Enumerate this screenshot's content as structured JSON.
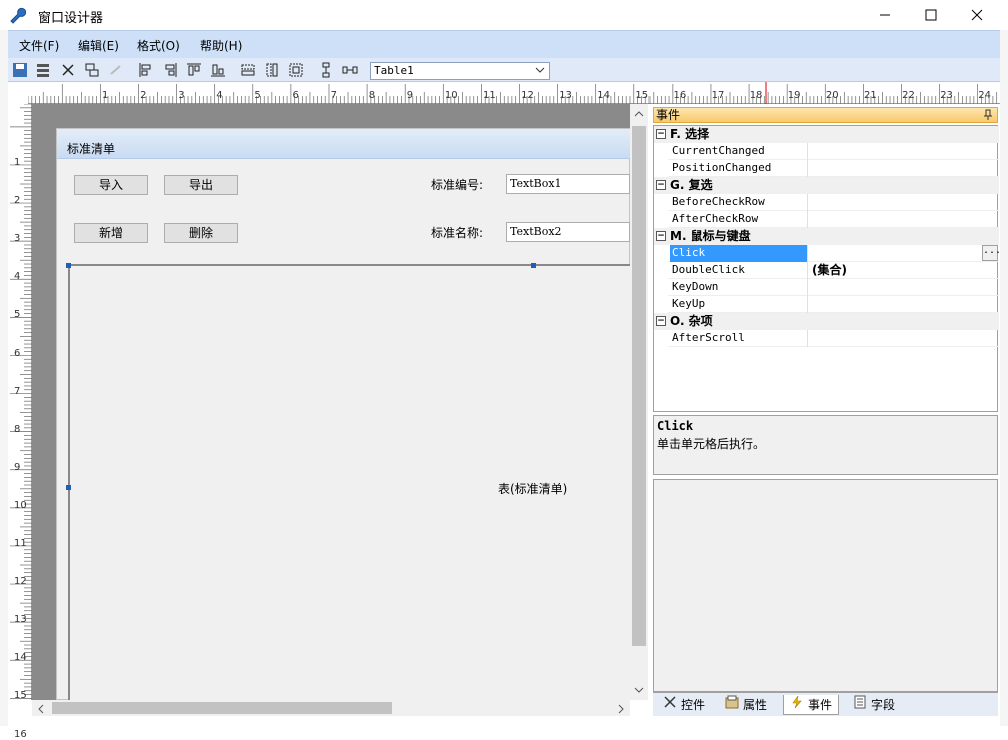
{
  "window": {
    "title": "窗口设计器"
  },
  "menu": {
    "items": [
      "文件(F)",
      "编辑(E)",
      "格式(O)",
      "帮助(H)"
    ]
  },
  "toolbar": {
    "table_select": "Table1"
  },
  "ruler": {
    "h_numbers": [
      "1",
      "2",
      "3",
      "4",
      "5",
      "6",
      "7",
      "8",
      "9",
      "10",
      "11",
      "12",
      "13",
      "14",
      "15",
      "16",
      "17",
      "18",
      "19",
      "20",
      "21",
      "22",
      "23",
      "24"
    ],
    "v_numbers": [
      "1",
      "2",
      "3",
      "4",
      "5",
      "6",
      "7",
      "8",
      "9",
      "10",
      "11",
      "12",
      "13",
      "14",
      "15",
      "16"
    ]
  },
  "form": {
    "title": "标准清单",
    "buttons": {
      "import": "导入",
      "export": "导出",
      "add": "新增",
      "delete": "删除"
    },
    "labels": {
      "code": "标准编号:",
      "name": "标准名称:"
    },
    "textboxes": {
      "code": "TextBox1",
      "name": "TextBox2"
    },
    "grid_caption": "表(标准清单)"
  },
  "props": {
    "header": "事件",
    "categories": [
      {
        "label": "F. 选择",
        "rows": [
          {
            "name": "CurrentChanged",
            "value": ""
          },
          {
            "name": "PositionChanged",
            "value": ""
          }
        ]
      },
      {
        "label": "G. 复选",
        "rows": [
          {
            "name": "BeforeCheckRow",
            "value": ""
          },
          {
            "name": "AfterCheckRow",
            "value": ""
          }
        ]
      },
      {
        "label": "M. 鼠标与键盘",
        "rows": [
          {
            "name": "Click",
            "value": ""
          },
          {
            "name": "DoubleClick",
            "value": "(集合)"
          },
          {
            "name": "KeyDown",
            "value": ""
          },
          {
            "name": "KeyUp",
            "value": ""
          }
        ]
      },
      {
        "label": "O. 杂项",
        "rows": [
          {
            "name": "AfterScroll",
            "value": ""
          }
        ]
      }
    ],
    "ellipsis": "...",
    "description": {
      "title": "Click",
      "text": "单击单元格后执行。"
    }
  },
  "tabs": [
    "控件",
    "属性",
    "事件",
    "字段"
  ],
  "colors": {
    "accent": "#3399ff",
    "header_orange": "#f8c96b",
    "menubar": "#cde0f7"
  }
}
